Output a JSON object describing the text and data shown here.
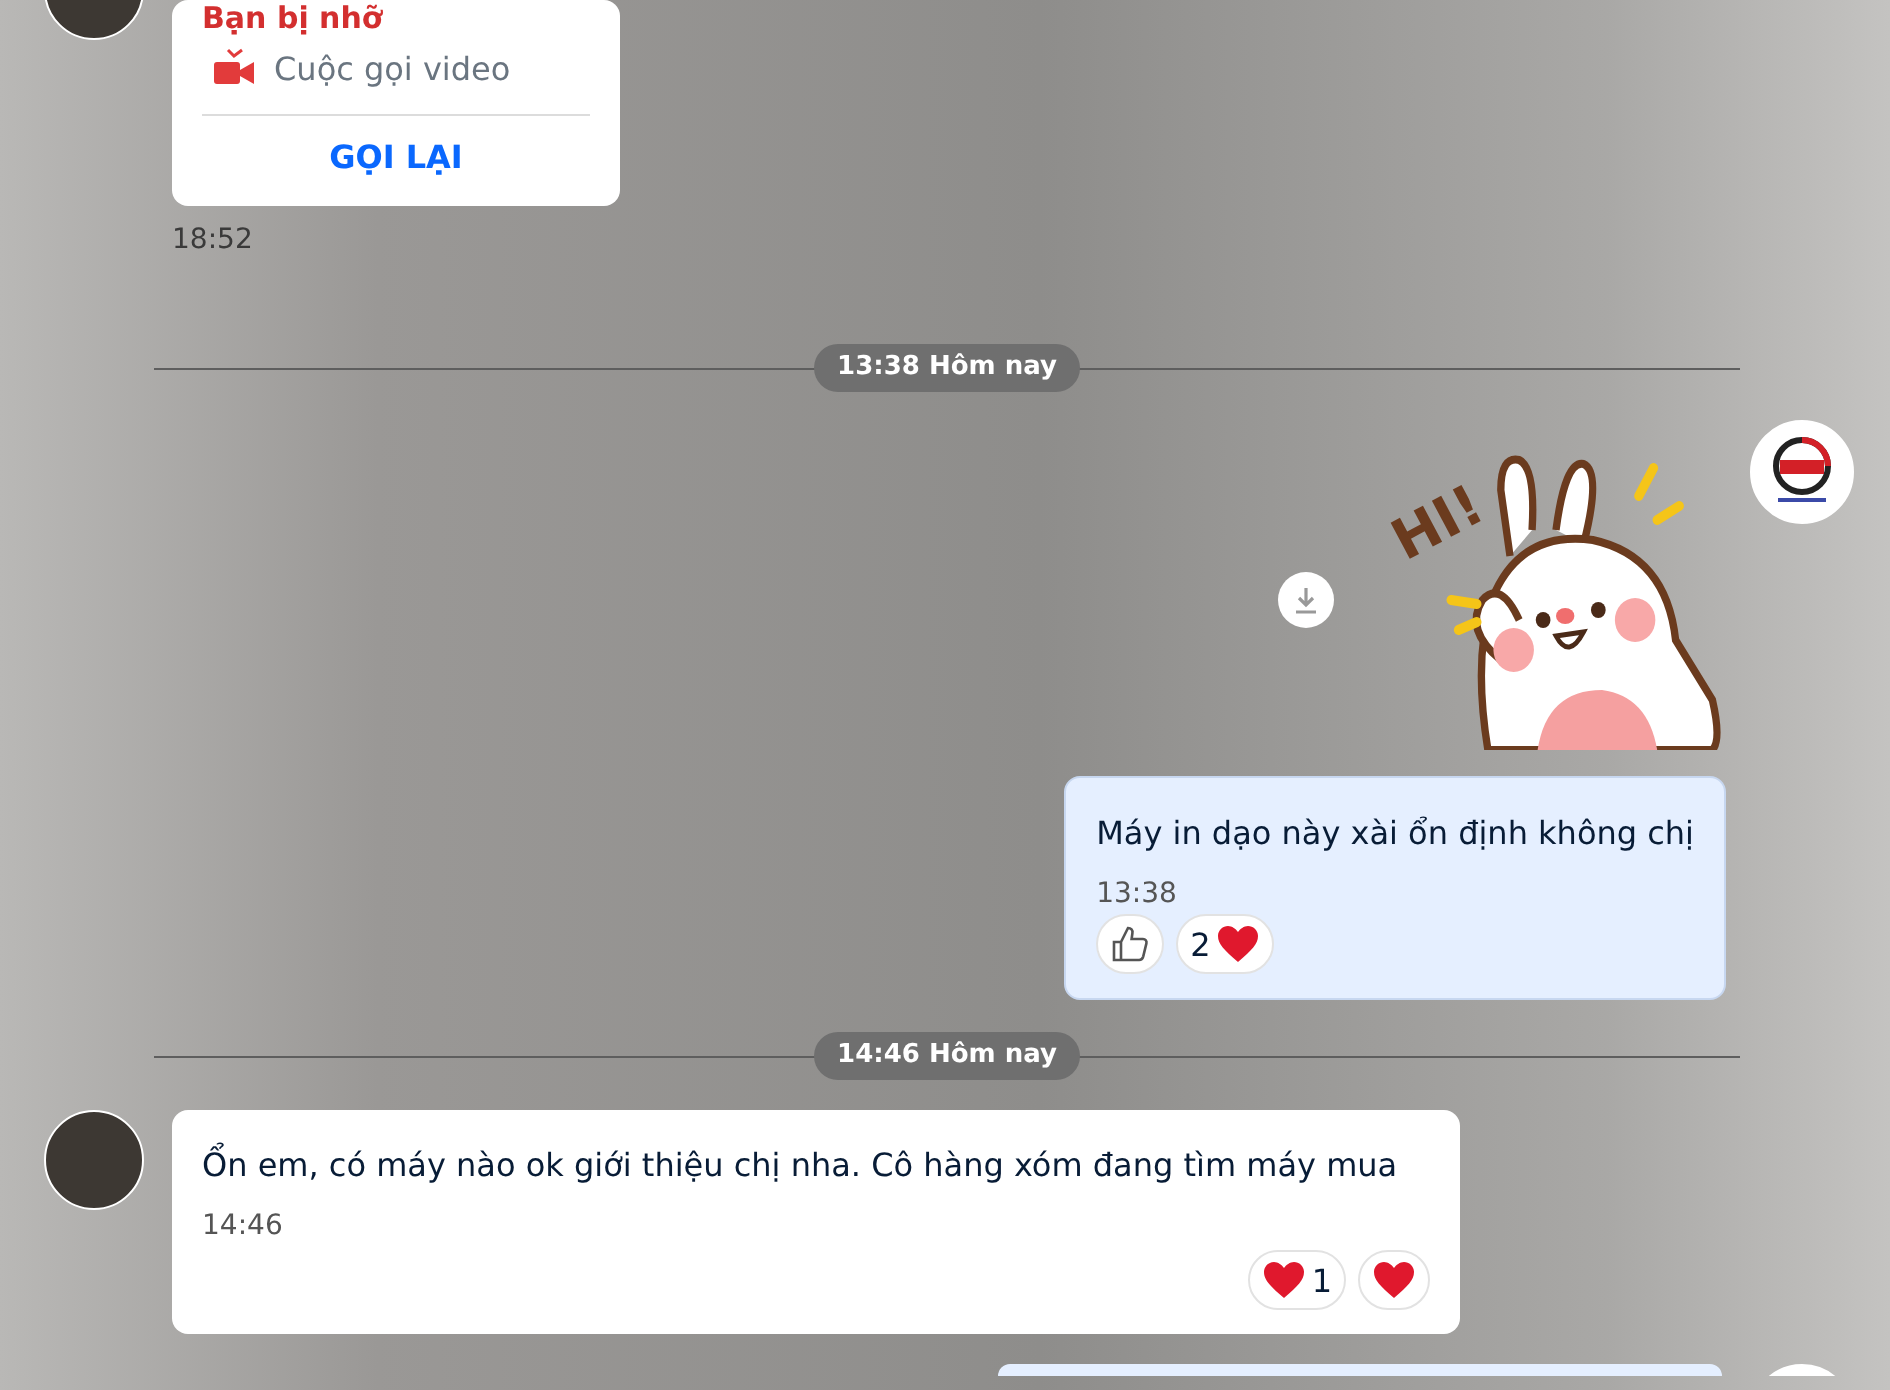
{
  "messages": [
    {
      "kind": "missed_call",
      "outgoing": false,
      "avatar": true,
      "title": "Bạn bị nhỡ",
      "call_type": "Cuộc gọi video",
      "action": "GỌI LẠI",
      "time": "18:52"
    },
    {
      "kind": "divider",
      "label": "13:38 Hôm nay"
    },
    {
      "kind": "sticker",
      "outgoing": true,
      "avatar": true,
      "sticker_text": "HI!"
    },
    {
      "kind": "text",
      "outgoing": true,
      "avatar": false,
      "text": "Máy in dạo này xài ổn định không chị",
      "time": "13:38",
      "reactions": [
        {
          "items": [
            {
              "kind": "like"
            }
          ]
        },
        {
          "items": [
            {
              "kind": "count",
              "text": "2"
            },
            {
              "kind": "heart"
            }
          ]
        }
      ]
    },
    {
      "kind": "divider",
      "label": "14:46 Hôm nay"
    },
    {
      "kind": "text",
      "outgoing": false,
      "avatar": true,
      "text": "Ổn em, có máy nào ok giới thiệu chị nha. Cô hàng xóm đang tìm máy mua",
      "time": "14:46",
      "reactions": [
        {
          "items": [
            {
              "kind": "heart"
            },
            {
              "kind": "count",
              "text": "1"
            }
          ]
        },
        {
          "items": [
            {
              "kind": "heart"
            }
          ]
        }
      ]
    },
    {
      "kind": "cutoff",
      "outgoing": true,
      "avatar": true
    }
  ]
}
